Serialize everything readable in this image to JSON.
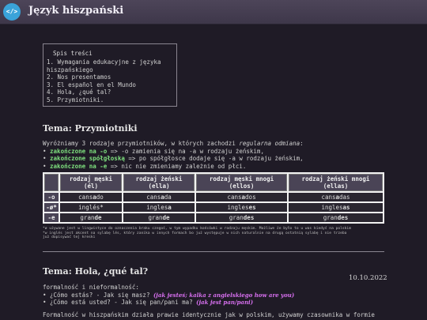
{
  "header": {
    "logo_text": "</>",
    "title": "Język hiszpański"
  },
  "toc": {
    "title": "Spis treści",
    "items": [
      "1. Wymagania edukacyjne z języka hiszpańskiego",
      "2. Nos presentamos",
      "3. El español en el Mundo",
      "4. Hola, ¿qué tal?",
      "5. Przymiotniki."
    ]
  },
  "section1": {
    "title": "Tema: Przymiotniki",
    "intro_pre": "Wyróżniamy 3 rodzaje przymiotników, w których zachodzi ",
    "intro_em": "regularna odmiana",
    "intro_post": ":",
    "rules": [
      {
        "bullet": "•",
        "key": "zakończone na -o",
        "rest": " => -o zamienia się na -a w rodzaju żeńskim,"
      },
      {
        "bullet": "•",
        "key": "zakończone spółgłoską",
        "rest": " => po spółgłosce dodaje się -a w rodzaju żeńskim,"
      },
      {
        "bullet": "•",
        "key": "zakończone na -e",
        "rest": " => nic nie zmieniamy zależnie od płci."
      }
    ],
    "table": {
      "headers": [
        "rodzaj męski (él)",
        "rodzaj żeński (ella)",
        "rodzaj męski mnogi (ellos)",
        "rodzaj żeński mnogi (ellas)"
      ],
      "rows": [
        {
          "label": "-o",
          "cells": [
            [
              "cans",
              "a",
              "do"
            ],
            [
              "cans",
              "a",
              "da"
            ],
            [
              "cans",
              "a",
              "dos"
            ],
            [
              "cans",
              "a",
              "das"
            ]
          ]
        },
        {
          "label": "-ø*",
          "cells": [
            [
              "inglés",
              "",
              "*"
            ],
            [
              "ingles",
              "a",
              ""
            ],
            [
              "ingles",
              "es",
              ""
            ],
            [
              "ingles",
              "as",
              ""
            ]
          ]
        },
        {
          "label": "-e",
          "cells": [
            [
              "gran",
              "de",
              ""
            ],
            [
              "gran",
              "de",
              ""
            ],
            [
              "gran",
              "des",
              ""
            ],
            [
              "gran",
              "des",
              ""
            ]
          ]
        }
      ]
    },
    "notes": [
      "*ø używane jest w lingwistyce do oznaczenia braku czegoś, w tym wypadku końcówki w rodzaju męskim. Możliwe że było to u was kiedyś na polskim",
      "*w inglés jest akcent na sylabę lés, który zanika w innych formach bo już występuje w nich naturalnie na drugą ostatnią sylabę i nie trzeba",
      "już dopisywać tej kreski"
    ]
  },
  "section2": {
    "title": "Tema: Hola, ¿qué tal?",
    "date": "10.10.2022",
    "lead": "formalność i nieformalność:",
    "items": [
      {
        "bullet": "•",
        "text": "¿Cómo estás? - Jak się masz? ",
        "note": "(jak jesteś; kalka z angielskiego how are you)"
      },
      {
        "bullet": "•",
        "text": "¿Cómo está usted? - Jak się pan/pani ma? ",
        "note": "(jak jest pan/pani)"
      }
    ],
    "para_line1": "Formalność w hiszpańskim działa prawie identycznie jak w polskim, używamy czasownika w formie"
  }
}
